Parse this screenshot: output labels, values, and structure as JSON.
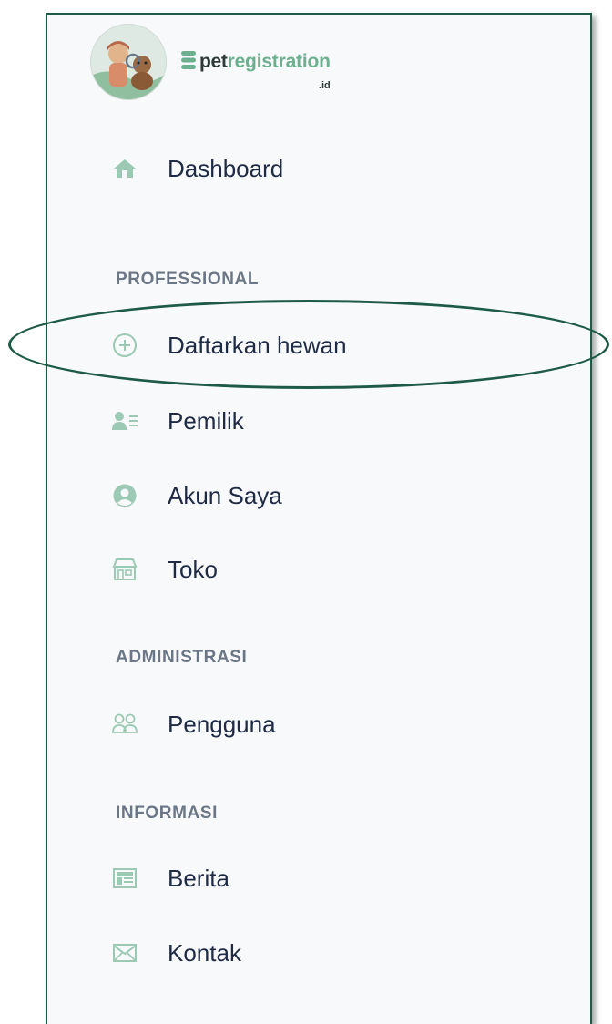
{
  "brand": {
    "name_part1": "pet",
    "name_part2": "registration",
    "tld": ".id"
  },
  "nav": {
    "dashboard": {
      "label": "Dashboard",
      "icon": "home-icon"
    },
    "sections": {
      "professional": "PROFESSIONAL",
      "administrasi": "ADMINISTRASI",
      "informasi": "INFORMASI"
    },
    "daftarkan_hewan": {
      "label": "Daftarkan hewan",
      "icon": "plus-circle-icon"
    },
    "pemilik": {
      "label": "Pemilik",
      "icon": "owner-list-icon"
    },
    "akun_saya": {
      "label": "Akun Saya",
      "icon": "user-circle-icon"
    },
    "toko": {
      "label": "Toko",
      "icon": "store-icon"
    },
    "pengguna": {
      "label": "Pengguna",
      "icon": "users-icon"
    },
    "berita": {
      "label": "Berita",
      "icon": "news-icon"
    },
    "kontak": {
      "label": "Kontak",
      "icon": "envelope-icon"
    }
  },
  "colors": {
    "icon": "#9cc9b4",
    "label": "#1f2a44",
    "section": "#6b7686",
    "border": "#1e5b47",
    "accent": "#6cb08f"
  }
}
